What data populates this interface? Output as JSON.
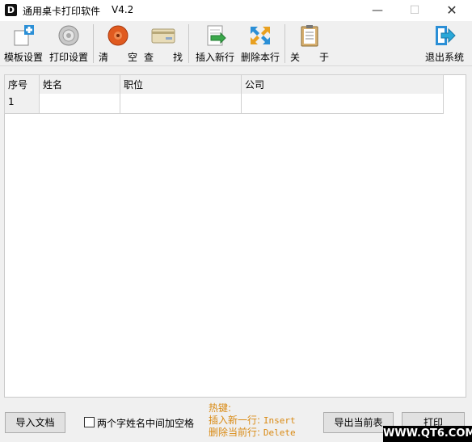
{
  "window": {
    "logo_text": "D",
    "title": "通用桌卡打印软件",
    "version": "V4.2",
    "min_glyph": "—",
    "max_glyph": "☐",
    "close_glyph": "✕"
  },
  "toolbar": {
    "items": [
      {
        "label": "模板设置",
        "icon": "template-plus-icon"
      },
      {
        "label": "打印设置",
        "icon": "gear-icon"
      },
      {
        "label": "清　　空",
        "icon": "clear-disc-icon"
      },
      {
        "label": "查　　找",
        "icon": "card-search-icon"
      },
      {
        "label": "插入新行",
        "icon": "insert-row-icon"
      },
      {
        "label": "删除本行",
        "icon": "delete-row-icon"
      },
      {
        "label": "关　　于",
        "icon": "clipboard-icon"
      },
      {
        "label": "退出系统",
        "icon": "exit-arrow-icon"
      }
    ]
  },
  "grid": {
    "columns": [
      "序号",
      "姓名",
      "职位",
      "公司"
    ],
    "rows": [
      [
        "1",
        "",
        "",
        ""
      ]
    ]
  },
  "bottom": {
    "import_label": "导入文档",
    "checkbox_label": "两个字姓名中间加空格",
    "checkbox_checked": false,
    "hotkeys_title": "热键:",
    "hotkey_insert_label": "插入新一行:",
    "hotkey_insert_key": "Insert",
    "hotkey_delete_label": "删除当前行:",
    "hotkey_delete_key": "Delete",
    "export_label": "导出当前表",
    "print_label": "打印"
  },
  "watermark": "WWW.QT6.COM",
  "colors": {
    "hotkey_text": "#d98a14",
    "accent_blue": "#2b8fd6",
    "clear_red": "#e05a1f"
  }
}
